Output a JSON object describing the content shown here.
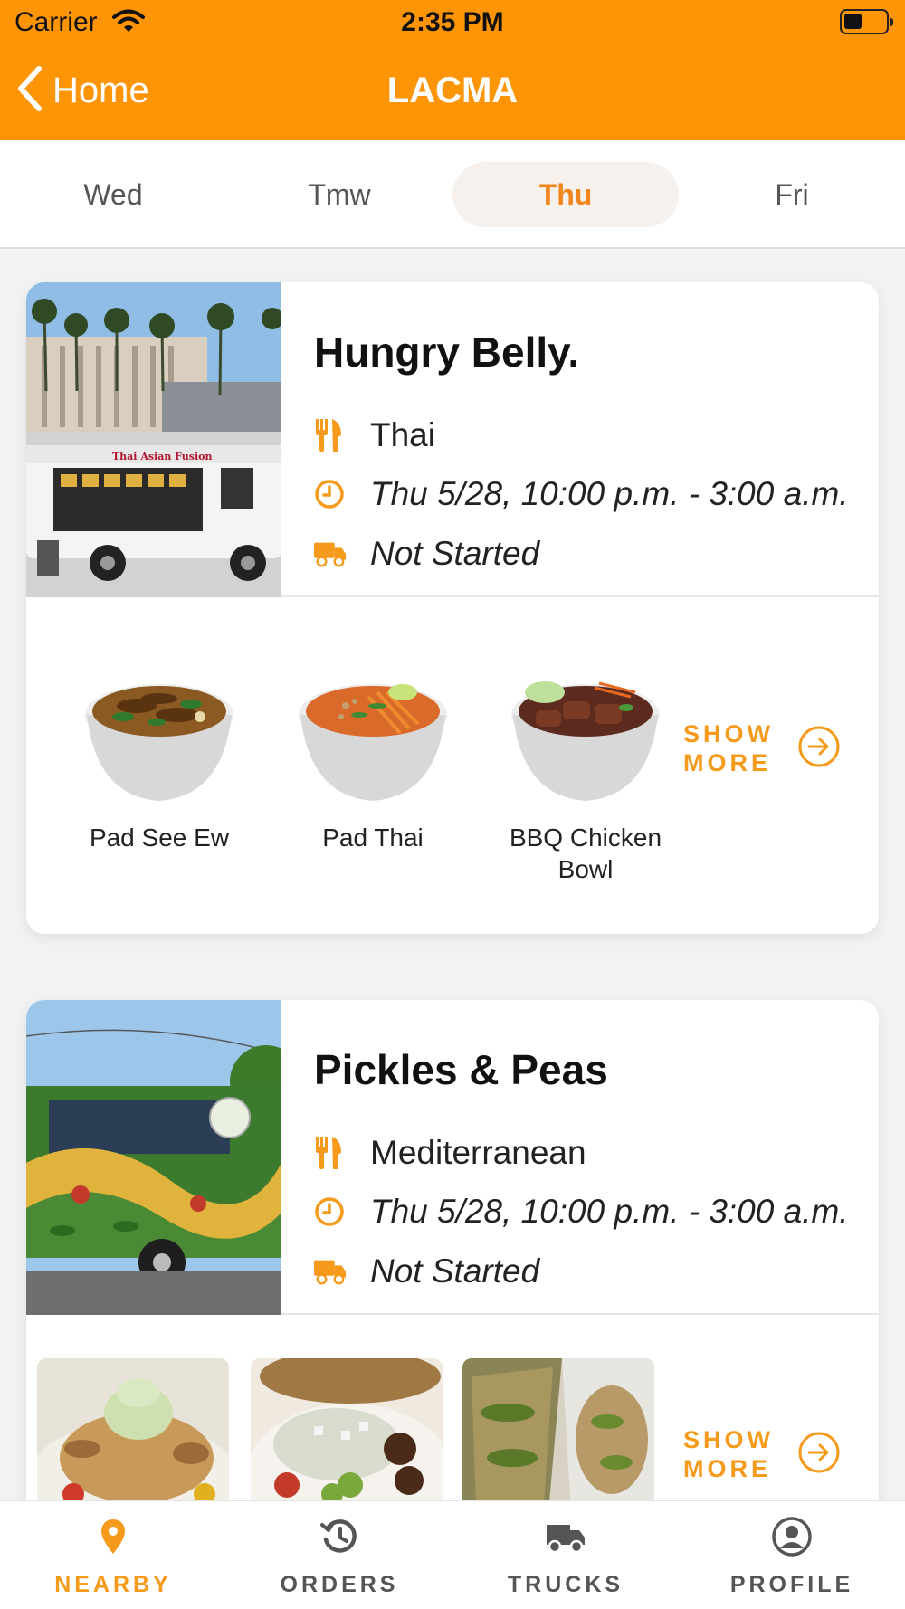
{
  "status_bar": {
    "carrier": "Carrier",
    "time": "2:35 PM"
  },
  "nav": {
    "back_label": "Home",
    "title": "LACMA"
  },
  "days": [
    {
      "label": "Wed",
      "active": false
    },
    {
      "label": "Tmw",
      "active": false
    },
    {
      "label": "Thu",
      "active": true
    },
    {
      "label": "Fri",
      "active": false
    }
  ],
  "trucks": [
    {
      "name": "Hungry Belly.",
      "cuisine": "Thai",
      "hours": "Thu 5/28, 10:00 p.m. - 3:00 a.m.",
      "status": "Not Started",
      "truck_sign": "Thai Asian Fusion",
      "menu": [
        {
          "name": "Pad See Ew",
          "icon": "pad-see-ew-bowl-image"
        },
        {
          "name": "Pad Thai",
          "icon": "pad-thai-bowl-image"
        },
        {
          "name": "BBQ Chicken Bowl",
          "icon": "bbq-chicken-bowl-image"
        }
      ],
      "show_more": "SHOW MORE"
    },
    {
      "name": "Pickles & Peas",
      "cuisine": "Mediterranean",
      "hours": "Thu 5/28, 10:00 p.m. - 3:00 a.m.",
      "status": "Not Started",
      "menu": [
        {
          "icon": "salad-plate-image"
        },
        {
          "icon": "mezze-bowl-image"
        },
        {
          "icon": "wrap-image"
        }
      ],
      "show_more": "SHOW MORE"
    }
  ],
  "tabs": [
    {
      "label": "NEARBY",
      "icon": "location-pin-icon",
      "active": true
    },
    {
      "label": "ORDERS",
      "icon": "history-icon",
      "active": false
    },
    {
      "label": "TRUCKS",
      "icon": "truck-icon",
      "active": false
    },
    {
      "label": "PROFILE",
      "icon": "profile-icon",
      "active": false
    }
  ],
  "colors": {
    "brand": "#fd9506",
    "accent": "#f59a1b",
    "active_day": "#f2851b"
  }
}
